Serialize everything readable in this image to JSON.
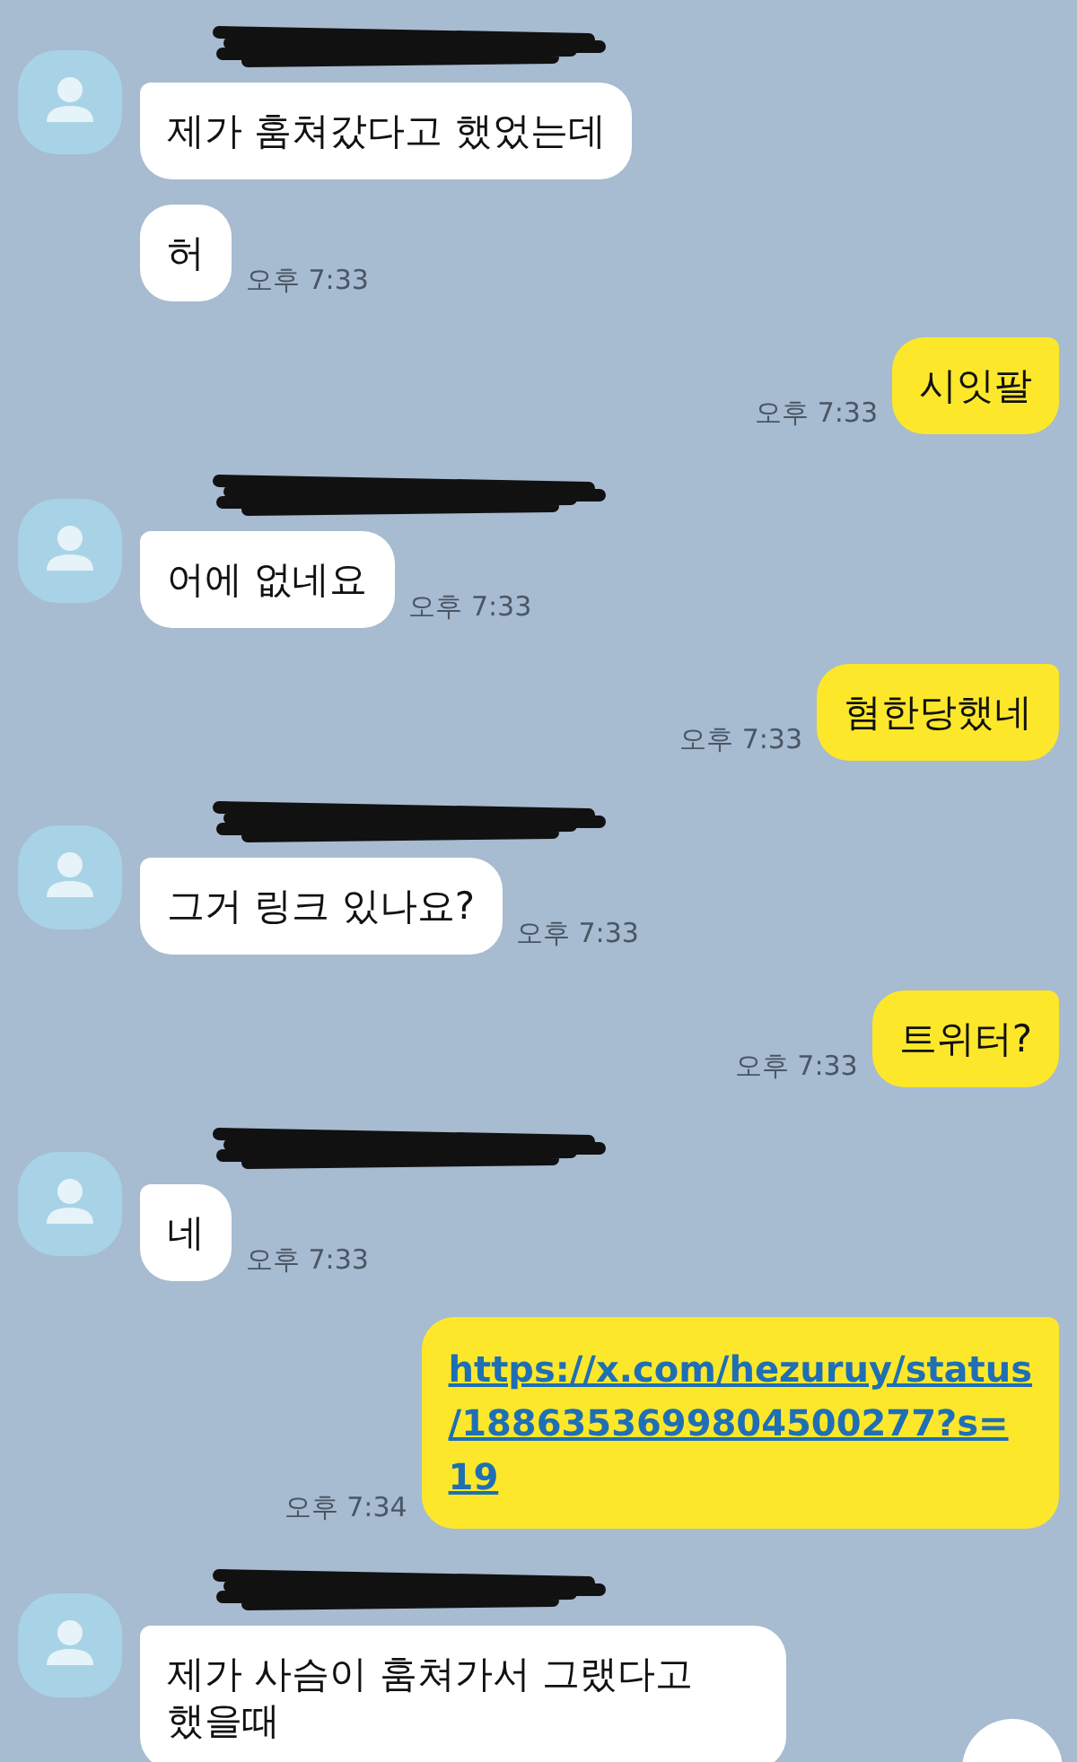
{
  "messages": [
    {
      "kind": "in",
      "name_redacted": true,
      "bubbles": [
        {
          "kind": "text",
          "text": "제가 훔쳐갔다고 했었는데"
        },
        {
          "kind": "text",
          "text": "허",
          "time": "오후 7:33"
        }
      ]
    },
    {
      "kind": "out",
      "bubbles": [
        {
          "kind": "text",
          "text": "시잇팔",
          "time": "오후 7:33"
        }
      ]
    },
    {
      "kind": "in",
      "name_redacted": true,
      "bubbles": [
        {
          "kind": "text",
          "text": "어에 없네요",
          "time": "오후 7:33"
        }
      ]
    },
    {
      "kind": "out",
      "bubbles": [
        {
          "kind": "text",
          "text": "혐한당했네",
          "time": "오후 7:33"
        }
      ]
    },
    {
      "kind": "in",
      "name_redacted": true,
      "bubbles": [
        {
          "kind": "text",
          "text": "그거 링크 있나요?",
          "time": "오후 7:33"
        }
      ]
    },
    {
      "kind": "out",
      "bubbles": [
        {
          "kind": "text",
          "text": "트위터?",
          "time": "오후 7:33"
        }
      ]
    },
    {
      "kind": "in",
      "name_redacted": true,
      "bubbles": [
        {
          "kind": "text",
          "text": "네",
          "time": "오후 7:33"
        }
      ]
    },
    {
      "kind": "out",
      "bubbles": [
        {
          "kind": "link",
          "lines": [
            "https://x.com/hezuruy/status",
            "/1886353699804500277?s=",
            "19"
          ],
          "time": "오후 7:34"
        }
      ]
    },
    {
      "kind": "in",
      "name_redacted": true,
      "bubbles": [
        {
          "kind": "text",
          "text": "제가 사슴이 훔쳐가서 그랬다고 했을때"
        }
      ]
    }
  ]
}
